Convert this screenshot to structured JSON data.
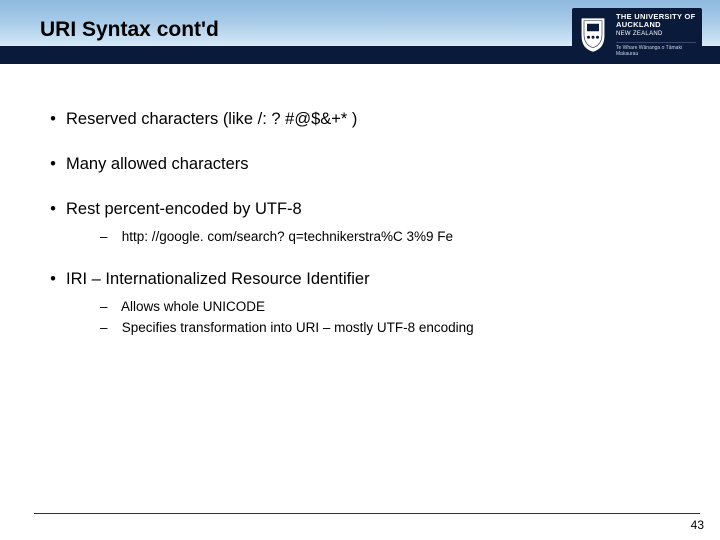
{
  "title": "URI Syntax cont'd",
  "logo": {
    "line1": "THE UNIVERSITY OF",
    "line2": "AUCKLAND",
    "nz": "NEW ZEALAND",
    "maori": "Te Whare Wānanga o Tāmaki Makaurau"
  },
  "bullets": [
    {
      "text": "Reserved characters (like /: ? #@$&+* )",
      "sub": []
    },
    {
      "text": "Many allowed characters",
      "sub": []
    },
    {
      "text": "Rest percent-encoded by UTF-8",
      "sub": [
        "http: //google. com/search? q=technikerstra%C 3%9 Fe"
      ]
    },
    {
      "text": "IRI – Internationalized Resource Identifier",
      "sub": [
        "Allows whole UNICODE",
        "Specifies transformation into URI – mostly UTF-8 encoding"
      ]
    }
  ],
  "pageNumber": "43"
}
